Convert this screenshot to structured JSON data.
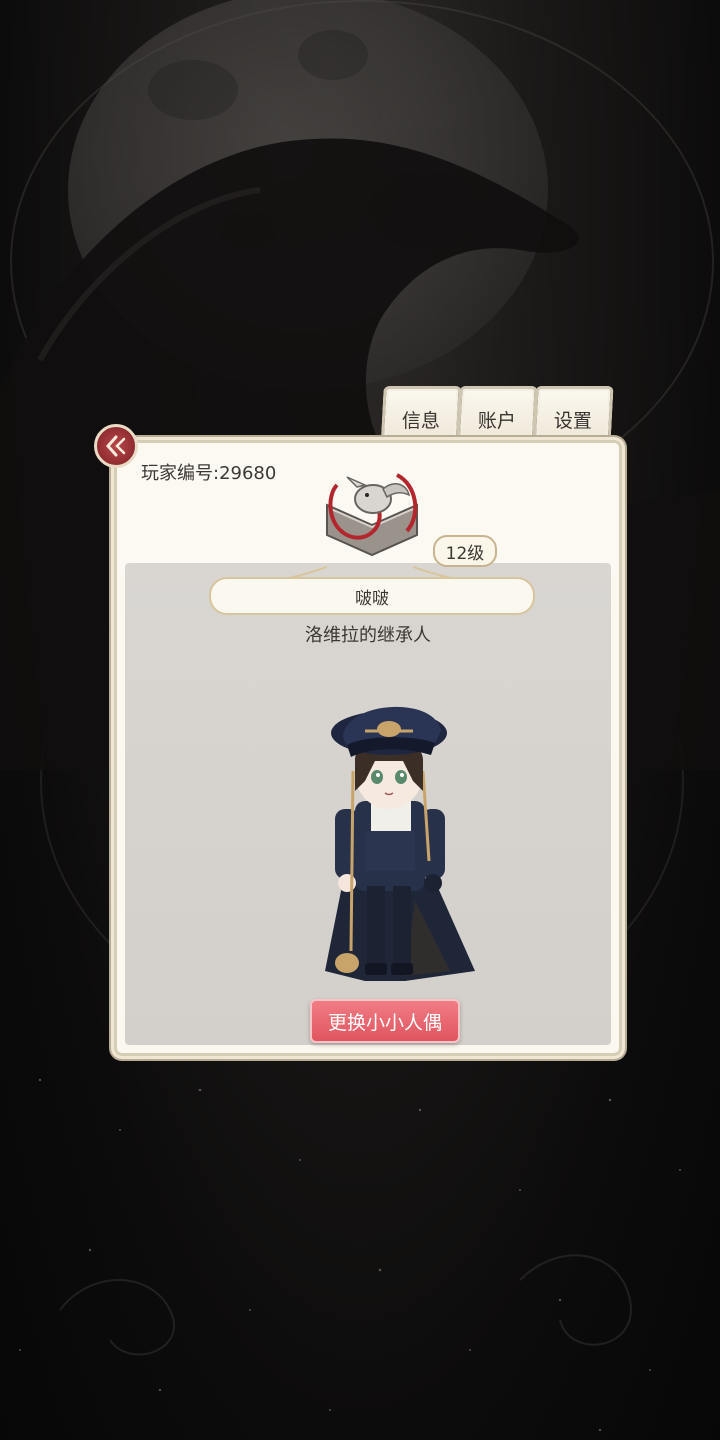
{
  "tabs": [
    {
      "label": "信息"
    },
    {
      "label": "账户"
    },
    {
      "label": "设置"
    }
  ],
  "profile": {
    "player_id": "玩家编号:29680",
    "level": "12级",
    "name": "啵啵",
    "title": "洛维拉的继承人",
    "change_doll_label": "更换小小人偶"
  },
  "icons": {
    "back": "back-chevron-icon",
    "emblem": "book-bird-emblem-icon"
  },
  "colors": {
    "accent_red": "#e0545f",
    "card_bg": "#fbf8f0",
    "border_gold": "#d9c59c"
  }
}
